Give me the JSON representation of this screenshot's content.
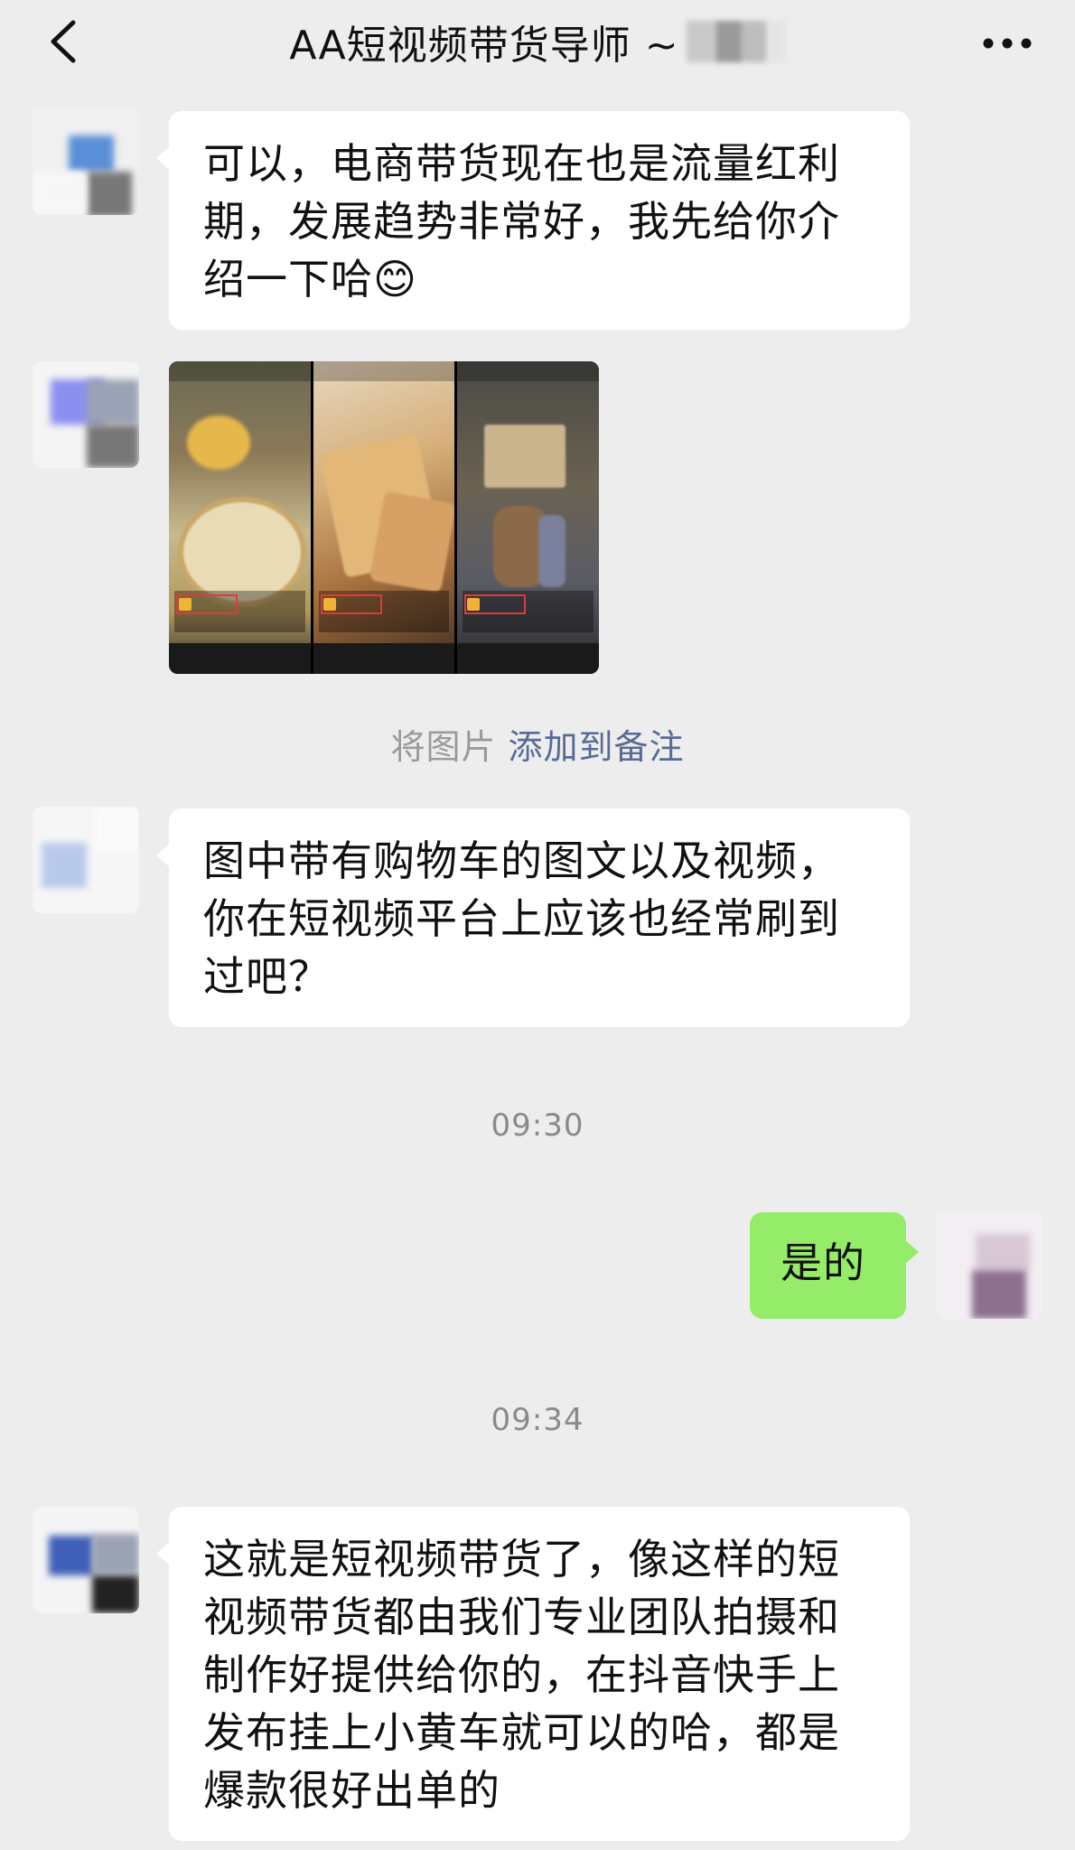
{
  "header": {
    "title": "AA短视频带货导师 ~",
    "back_icon": "chevron-left-icon",
    "more_icon": "more-horizontal-icon"
  },
  "messages": [
    {
      "from": "other",
      "type": "text",
      "text": "可以，电商带货现在也是流量红利期，发展趋势非常好，我先给你介绍一下哈😊"
    },
    {
      "from": "other",
      "type": "image"
    },
    {
      "type": "system",
      "prefix": "将图片 ",
      "link": "添加到备注"
    },
    {
      "from": "other",
      "type": "text",
      "text": "图中带有购物车的图文以及视频，你在短视频平台上应该也经常刷到过吧？"
    },
    {
      "type": "time",
      "text": "09:30"
    },
    {
      "from": "me",
      "type": "text",
      "text": "是的"
    },
    {
      "type": "time",
      "text": "09:34"
    },
    {
      "from": "other",
      "type": "text",
      "text": "这就是短视频带货了，像这样的短视频带货都由我们专业团队拍摄和制作好提供给你的，在抖音快手上发布挂上小黄车就可以的哈，都是爆款很好出单的"
    }
  ],
  "colors": {
    "background": "#ededed",
    "bubble_in": "#ffffff",
    "bubble_out": "#95ec69",
    "link": "#576b95",
    "timestamp": "#8a8a8a"
  }
}
